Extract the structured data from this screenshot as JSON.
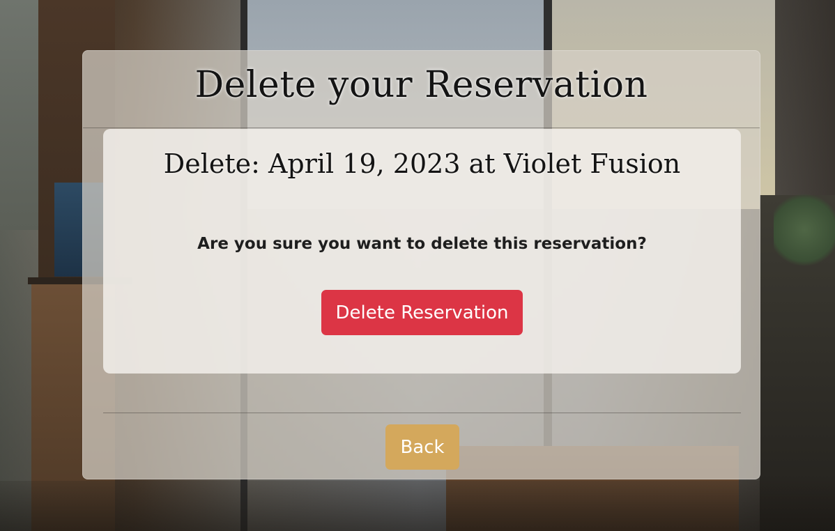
{
  "header": {
    "title": "Delete your Reservation"
  },
  "reservation": {
    "heading": "Delete: April 19, 2023 at Violet Fusion",
    "confirm_question": "Are you sure you want to delete this reservation?",
    "delete_label": "Delete Reservation"
  },
  "footer": {
    "back_label": "Back"
  },
  "colors": {
    "delete_button": "#dc3545",
    "back_button": "#d4a85c"
  }
}
